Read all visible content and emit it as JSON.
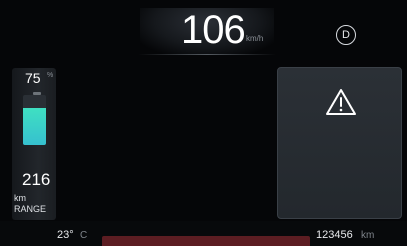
{
  "speed": {
    "value": "106",
    "unit": "km/h"
  },
  "gear": {
    "label": "D"
  },
  "battery": {
    "percent": "75",
    "percent_unit": "%",
    "fill_fraction": 0.75,
    "fill_color": "#3fe0c2"
  },
  "range": {
    "value": "216",
    "unit": "km",
    "label": "RANGE"
  },
  "warning": {
    "icon": "warning-triangle-icon"
  },
  "status": {
    "temperature": "23°",
    "temperature_unit": "C",
    "odometer": "123456",
    "odometer_unit": "km"
  }
}
